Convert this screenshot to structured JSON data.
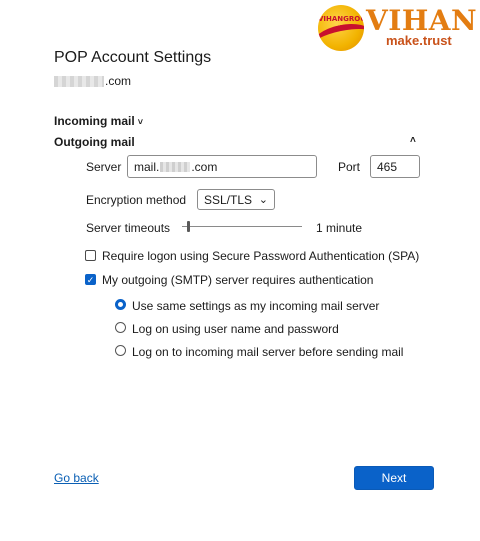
{
  "brand": {
    "circle_text": "VIHANGROUP",
    "word": "VIHAN",
    "tagline": "make.trust"
  },
  "header": {
    "title": "POP Account Settings",
    "email_suffix": ".com"
  },
  "incoming": {
    "label": "Incoming mail",
    "chevron": "˅"
  },
  "outgoing": {
    "label": "Outgoing mail",
    "collapse_glyph": "˄",
    "server_label": "Server",
    "server_prefix": "mail.",
    "server_suffix": ".com",
    "port_label": "Port",
    "port_value": "465",
    "encryption_label": "Encryption method",
    "encryption_value": "SSL/TLS",
    "encryption_chevron": "⌄",
    "timeout_label": "Server timeouts",
    "timeout_value": "1 minute",
    "timeout_level": 0.05
  },
  "options": {
    "spa": {
      "label": "Require logon using Secure Password Authentication (SPA)",
      "checked": false
    },
    "smtp_auth": {
      "label": "My outgoing (SMTP) server requires authentication",
      "checked": true,
      "check_glyph": "✓"
    },
    "radios": [
      {
        "label": "Use same settings as my incoming mail server",
        "selected": true
      },
      {
        "label": "Log on using user name and password",
        "selected": false
      },
      {
        "label": "Log on to incoming mail server before sending mail",
        "selected": false
      }
    ]
  },
  "footer": {
    "back_label": "Go back",
    "next_label": "Next"
  },
  "colors": {
    "accent": "#0a62c9",
    "link": "#0a5fb4",
    "brand_orange": "#e37d12"
  }
}
